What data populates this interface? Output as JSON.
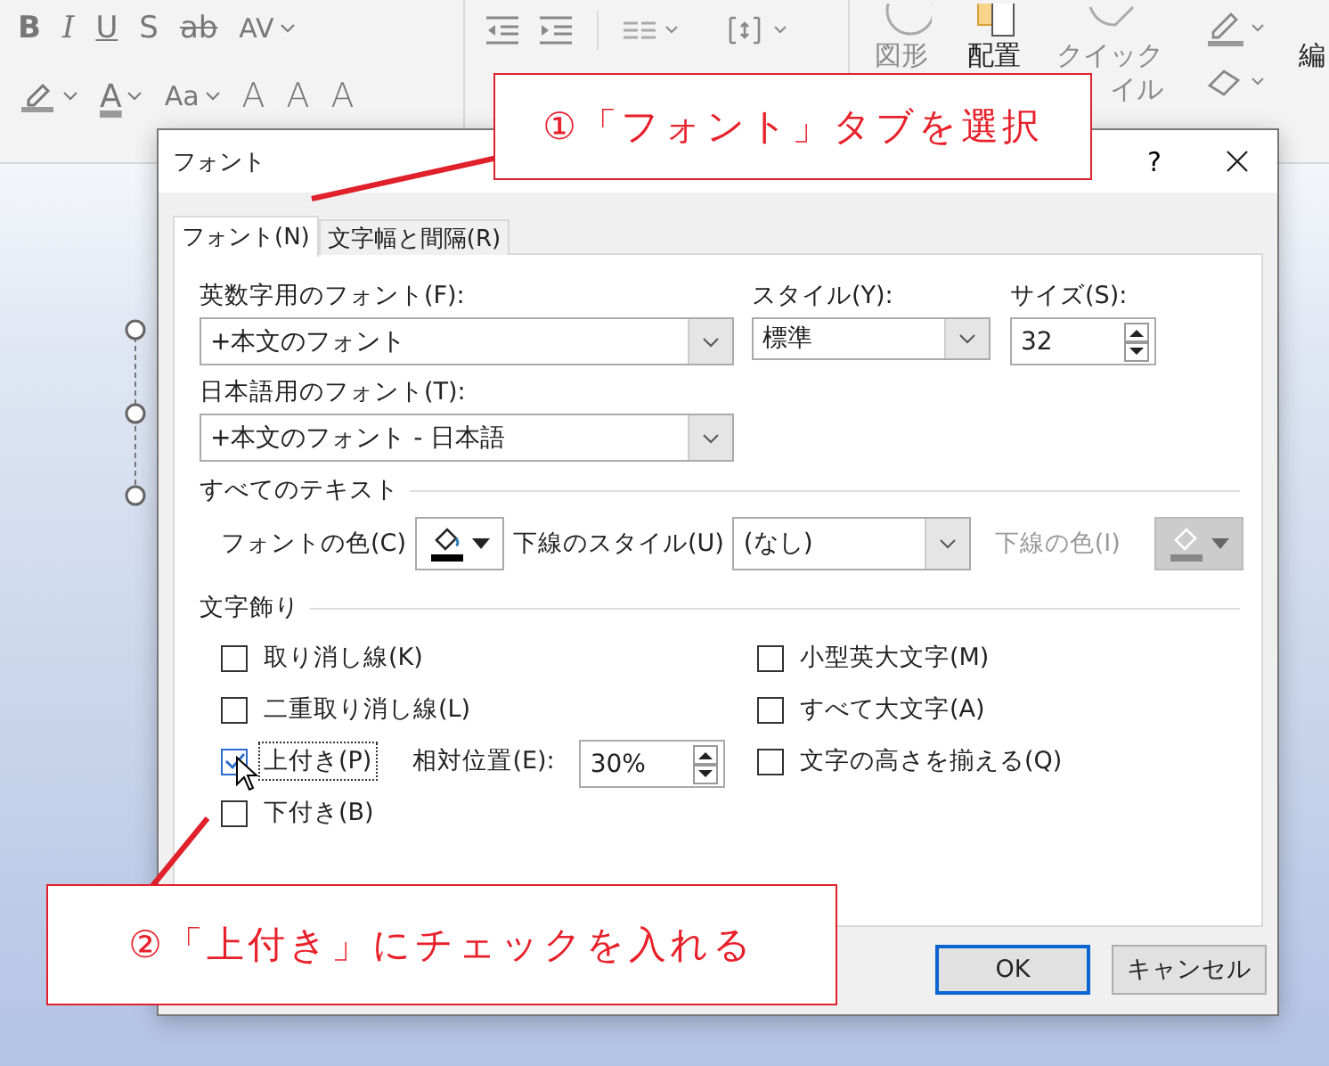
{
  "ribbon": {
    "font_tools": [
      {
        "kind": "bold",
        "text": "B",
        "caret": false
      },
      {
        "kind": "italic",
        "text": "I",
        "caret": false
      },
      {
        "kind": "underline",
        "text": "U",
        "caret": false
      },
      {
        "kind": "shadow",
        "text": "S",
        "caret": false
      },
      {
        "kind": "strike",
        "text": "ab",
        "caret": false
      },
      {
        "kind": "spacing",
        "text": "AV",
        "caret": true
      }
    ],
    "font_tools_row2": [
      {
        "kind": "highlight",
        "caret": true
      },
      {
        "kind": "color",
        "text": "A",
        "caret": true
      },
      {
        "kind": "case",
        "text": "Aa",
        "caret": true
      },
      {
        "kind": "grow",
        "text": "A",
        "caret": false
      },
      {
        "kind": "shrink",
        "text": "A",
        "caret": false
      },
      {
        "kind": "clear",
        "text": "A",
        "caret": false
      }
    ],
    "drawing_buttons": [
      {
        "kind": "shapes",
        "lines": [
          "図形"
        ],
        "disabled": true
      },
      {
        "kind": "arrange",
        "lines": [
          "配置"
        ],
        "disabled": false
      },
      {
        "kind": "quick-style",
        "lines": [
          "クイック",
          "イル"
        ],
        "disabled": true
      }
    ],
    "edge_label": "編"
  },
  "dialog": {
    "title": "フォント",
    "help": "?",
    "tabs": [
      {
        "label": "フォント(N)",
        "selected": true
      },
      {
        "label": "文字幅と間隔(R)",
        "selected": false
      }
    ],
    "latin_font": {
      "label": "英数字用のフォント(F):",
      "value": "+本文のフォント"
    },
    "style": {
      "label": "スタイル(Y):",
      "value": "標準"
    },
    "size": {
      "label": "サイズ(S):",
      "value": "32"
    },
    "japanese_font": {
      "label": "日本語用のフォント(T):",
      "value": "+本文のフォント - 日本語"
    },
    "all_text": {
      "heading": "すべてのテキスト",
      "font_color": {
        "label": "フォントの色(C)",
        "disabled": false
      },
      "underline_style": {
        "label": "下線のスタイル(U)",
        "value": "(なし)"
      },
      "underline_color": {
        "label": "下線の色(I)",
        "disabled": true
      }
    },
    "effects": {
      "heading": "文字飾り",
      "left": [
        {
          "label": "取り消し線(K)",
          "checked": false,
          "focused": false
        },
        {
          "label": "二重取り消し線(L)",
          "checked": false,
          "focused": false
        },
        {
          "label": "上付き(P)",
          "checked": true,
          "focused": true
        },
        {
          "label": "下付き(B)",
          "checked": false,
          "focused": false
        }
      ],
      "offset": {
        "label": "相対位置(E):",
        "value": "30%"
      },
      "right": [
        {
          "label": "小型英大文字(M)",
          "checked": false,
          "focused": false
        },
        {
          "label": "すべて大文字(A)",
          "checked": false,
          "focused": false
        },
        {
          "label": "文字の高さを揃える(Q)",
          "checked": false,
          "focused": false
        }
      ]
    },
    "buttons": [
      {
        "label": "OK",
        "default": true
      },
      {
        "label": "キャンセル",
        "default": false
      }
    ]
  },
  "callouts": [
    {
      "text": "①「フォント」タブを選択"
    },
    {
      "text": "②「上付き」にチェックを入れる"
    }
  ]
}
